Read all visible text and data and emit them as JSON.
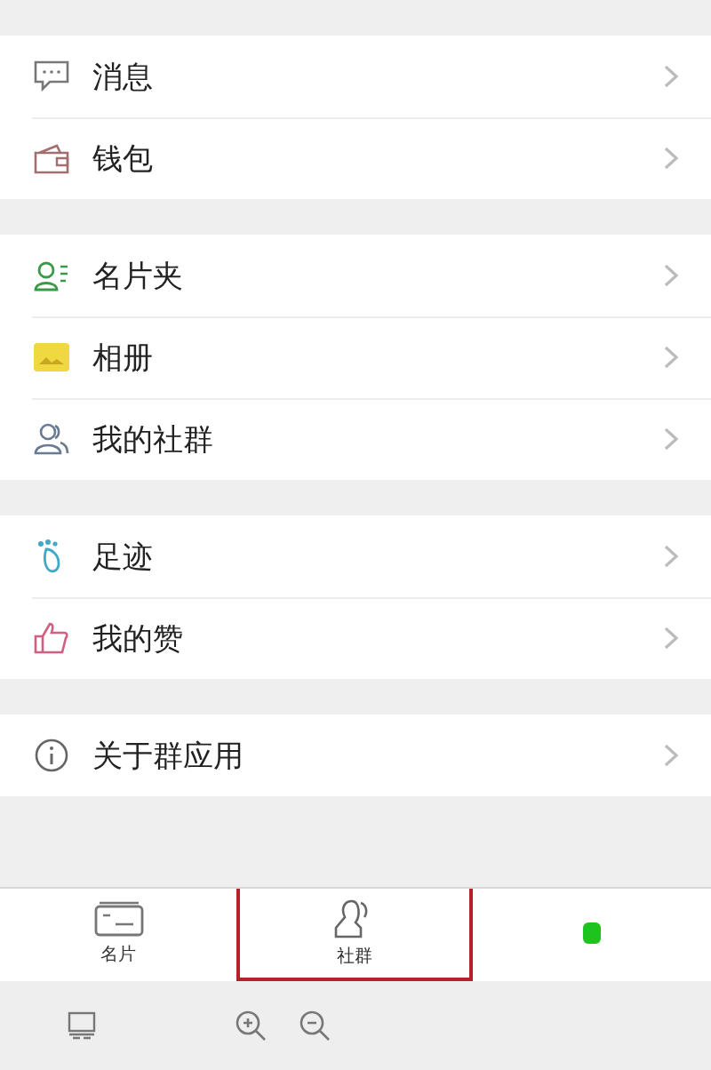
{
  "sections": [
    {
      "items": [
        {
          "label": "消息"
        },
        {
          "label": "钱包"
        }
      ]
    },
    {
      "items": [
        {
          "label": "名片夹"
        },
        {
          "label": "相册"
        },
        {
          "label": "我的社群"
        }
      ]
    },
    {
      "items": [
        {
          "label": "足迹"
        },
        {
          "label": "我的赞"
        }
      ]
    },
    {
      "items": [
        {
          "label": "关于群应用"
        }
      ]
    }
  ],
  "tab_bar": [
    {
      "label": "名片",
      "selected": false
    },
    {
      "label": "社群",
      "selected": true
    },
    {
      "selected": false
    }
  ]
}
